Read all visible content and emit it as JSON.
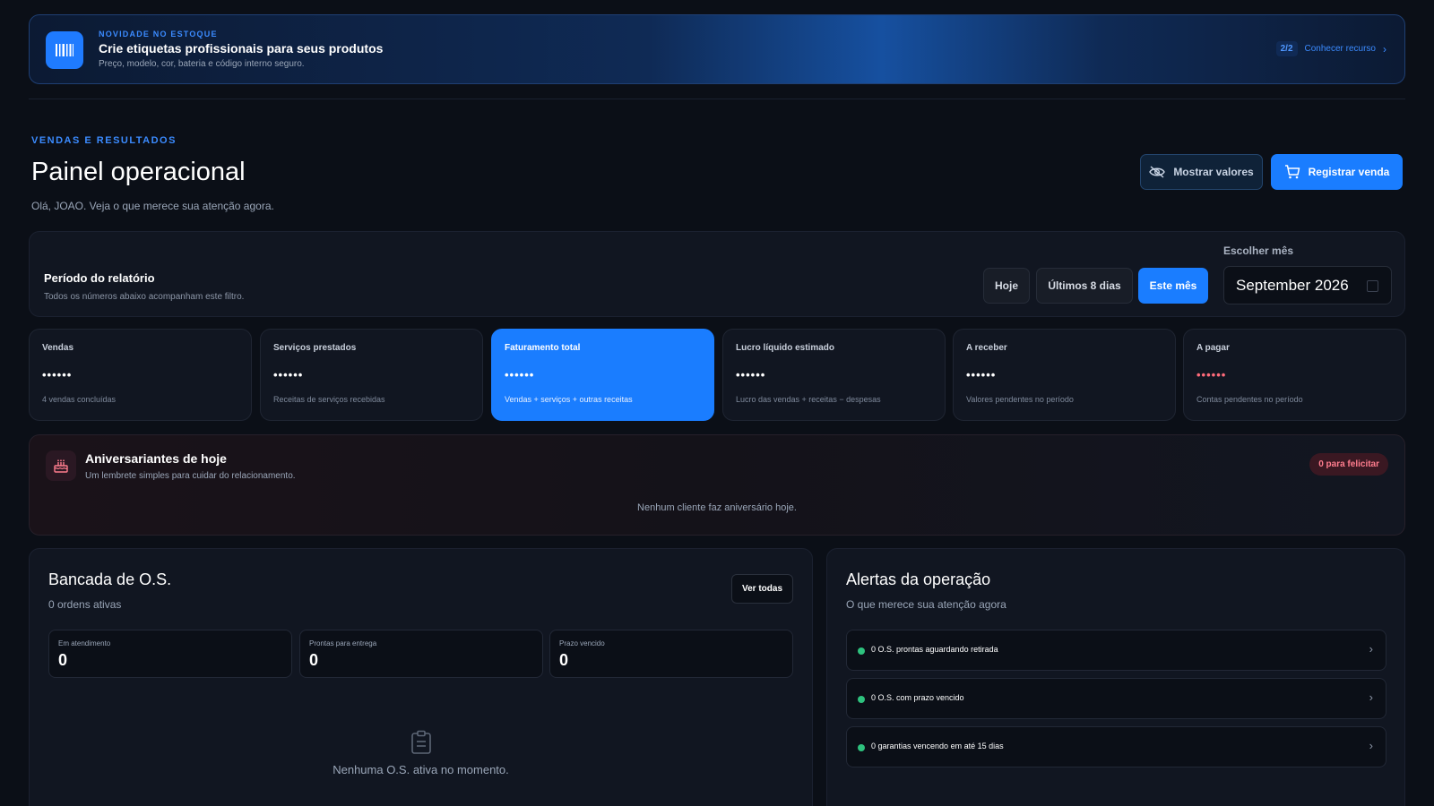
{
  "banner": {
    "eyebrow": "NOVIDADE NO ESTOQUE",
    "title": "Crie etiquetas profissionais para seus produtos",
    "subtitle": "Preço, modelo, cor, bateria e código interno seguro.",
    "counter": "2/2",
    "link": "Conhecer recurso"
  },
  "header": {
    "eyebrow": "VENDAS E RESULTADOS",
    "title": "Painel operacional",
    "greeting": "Olá, JOAO. Veja o que merece sua atenção agora.",
    "show_values_label": "Mostrar valores",
    "register_sale_label": "Registrar venda"
  },
  "period": {
    "title": "Período do relatório",
    "subtitle": "Todos os números abaixo acompanham este filtro.",
    "options": [
      "Hoje",
      "Últimos 8 dias",
      "Este mês"
    ],
    "selected": "Este mês",
    "month_label": "Escolher mês",
    "month_value": "September 2026"
  },
  "stats": [
    {
      "label": "Vendas",
      "value": "••••••",
      "sub": "4 vendas concluídas"
    },
    {
      "label": "Serviços prestados",
      "value": "••••••",
      "sub": "Receitas de serviços recebidas"
    },
    {
      "label": "Faturamento total",
      "value": "••••••",
      "sub": "Vendas + serviços + outras receitas"
    },
    {
      "label": "Lucro líquido estimado",
      "value": "••••••",
      "sub": "Lucro das vendas + receitas − despesas"
    },
    {
      "label": "A receber",
      "value": "••••••",
      "sub": "Valores pendentes no período"
    },
    {
      "label": "A pagar",
      "value": "••••••",
      "sub": "Contas pendentes no período"
    }
  ],
  "birthdays": {
    "title": "Aniversariantes de hoje",
    "subtitle": "Um lembrete simples para cuidar do relacionamento.",
    "badge": "0 para felicitar",
    "empty": "Nenhum cliente faz aniversário hoje."
  },
  "bench": {
    "title": "Bancada de O.S.",
    "subtitle": "0 ordens ativas",
    "view_all": "Ver todas",
    "stats": [
      {
        "label": "Em atendimento",
        "value": "0"
      },
      {
        "label": "Prontas para entrega",
        "value": "0"
      },
      {
        "label": "Prazo vencido",
        "value": "0"
      }
    ],
    "empty": "Nenhuma O.S. ativa no momento."
  },
  "alerts": {
    "title": "Alertas da operação",
    "subtitle": "O que merece sua atenção agora",
    "items": [
      "0 O.S. prontas aguardando retirada",
      "0 O.S. com prazo vencido",
      "0 garantias vencendo em até 15 dias"
    ]
  },
  "colors": {
    "accent": "#1a7dff",
    "background": "#0b0f17",
    "panel": "#111621",
    "status_ok": "#2ec27e",
    "danger": "#ff6b7a"
  },
  "icons": {
    "banner": "barcode-icon",
    "show_values": "eye-off-icon",
    "register_sale": "cart-icon",
    "birthday": "cake-icon",
    "empty_bench": "clipboard-icon",
    "alert_chevron": "chevron-right-icon"
  }
}
